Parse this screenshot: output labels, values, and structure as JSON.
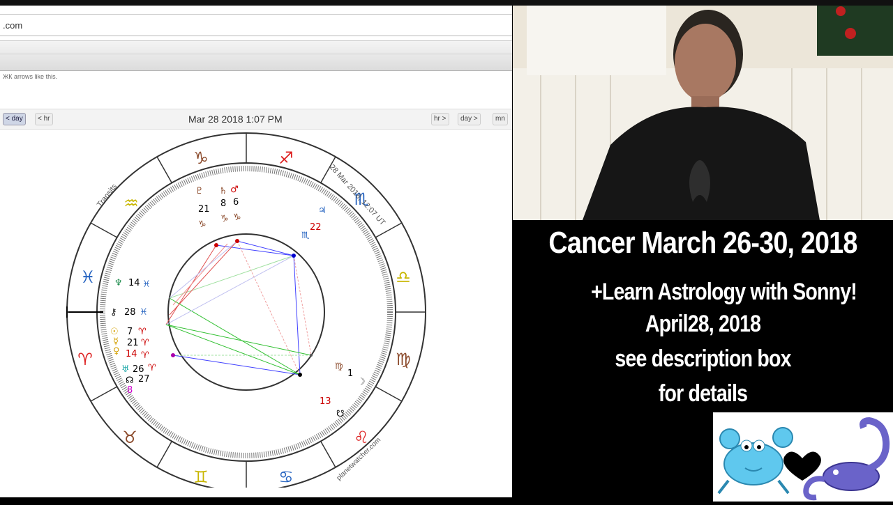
{
  "browser": {
    "url": ".com",
    "hint_text": "ЖК arrows like this.",
    "nav": {
      "left_buttons": [
        "< day",
        "< hr"
      ],
      "date": "Mar 28 2018 1:07 PM",
      "right_buttons": [
        "hr >",
        "day >",
        "mn"
      ]
    }
  },
  "astro_chart": {
    "label_transits": "Transits",
    "label_time": "28 Mar 2018, 12:07 UT",
    "label_site": "planetwatcher.com",
    "zodiac_signs": [
      "♑",
      "♐",
      "♏",
      "♎",
      "♍",
      "♌",
      "♋",
      "♊",
      "♉",
      "♈",
      "♓",
      "♒"
    ],
    "planets": {
      "pluto": {
        "glyph": "♇",
        "deg": "21",
        "sign": "♑"
      },
      "saturn": {
        "glyph": "♄",
        "deg": "8",
        "sign": "♑"
      },
      "mars": {
        "glyph": "♂",
        "deg": "6",
        "sign": "♑"
      },
      "jupiter": {
        "glyph": "♃",
        "deg": "22",
        "sign": "♏"
      },
      "neptune": {
        "glyph": "♆",
        "deg": "14",
        "sign": "♓"
      },
      "chiron": {
        "glyph": "⚷",
        "deg": "28",
        "sign": "♓"
      },
      "sun": {
        "glyph": "☉",
        "deg": "7",
        "sign": "♈"
      },
      "mercury": {
        "glyph": "☿",
        "deg": "21",
        "sign": "♈"
      },
      "venus": {
        "glyph": "♀",
        "deg": "14",
        "sign": "♈"
      },
      "uranus": {
        "glyph": "♅",
        "deg": "26",
        "sign": "♈"
      },
      "node": {
        "glyph": "☊",
        "deg": "27",
        "sign": ""
      },
      "moon": {
        "glyph": "☽",
        "deg": "1",
        "sign": "♍"
      },
      "s_node": {
        "glyph": "☋",
        "deg": "13",
        "sign": ""
      },
      "lilith": {
        "glyph": "⚸",
        "deg": "8",
        "sign": ""
      }
    }
  },
  "overlay": {
    "title": "Cancer March 26-30, 2018",
    "lines": [
      "+Learn Astrology with Sonny!",
      "April28, 2018",
      "see description box",
      "for details"
    ]
  },
  "colors": {
    "overlay_bg": "#000000",
    "overlay_text": "#ffffff",
    "sticker_crab": "#5fc8ee",
    "sticker_scorpion": "#6a63c9"
  }
}
